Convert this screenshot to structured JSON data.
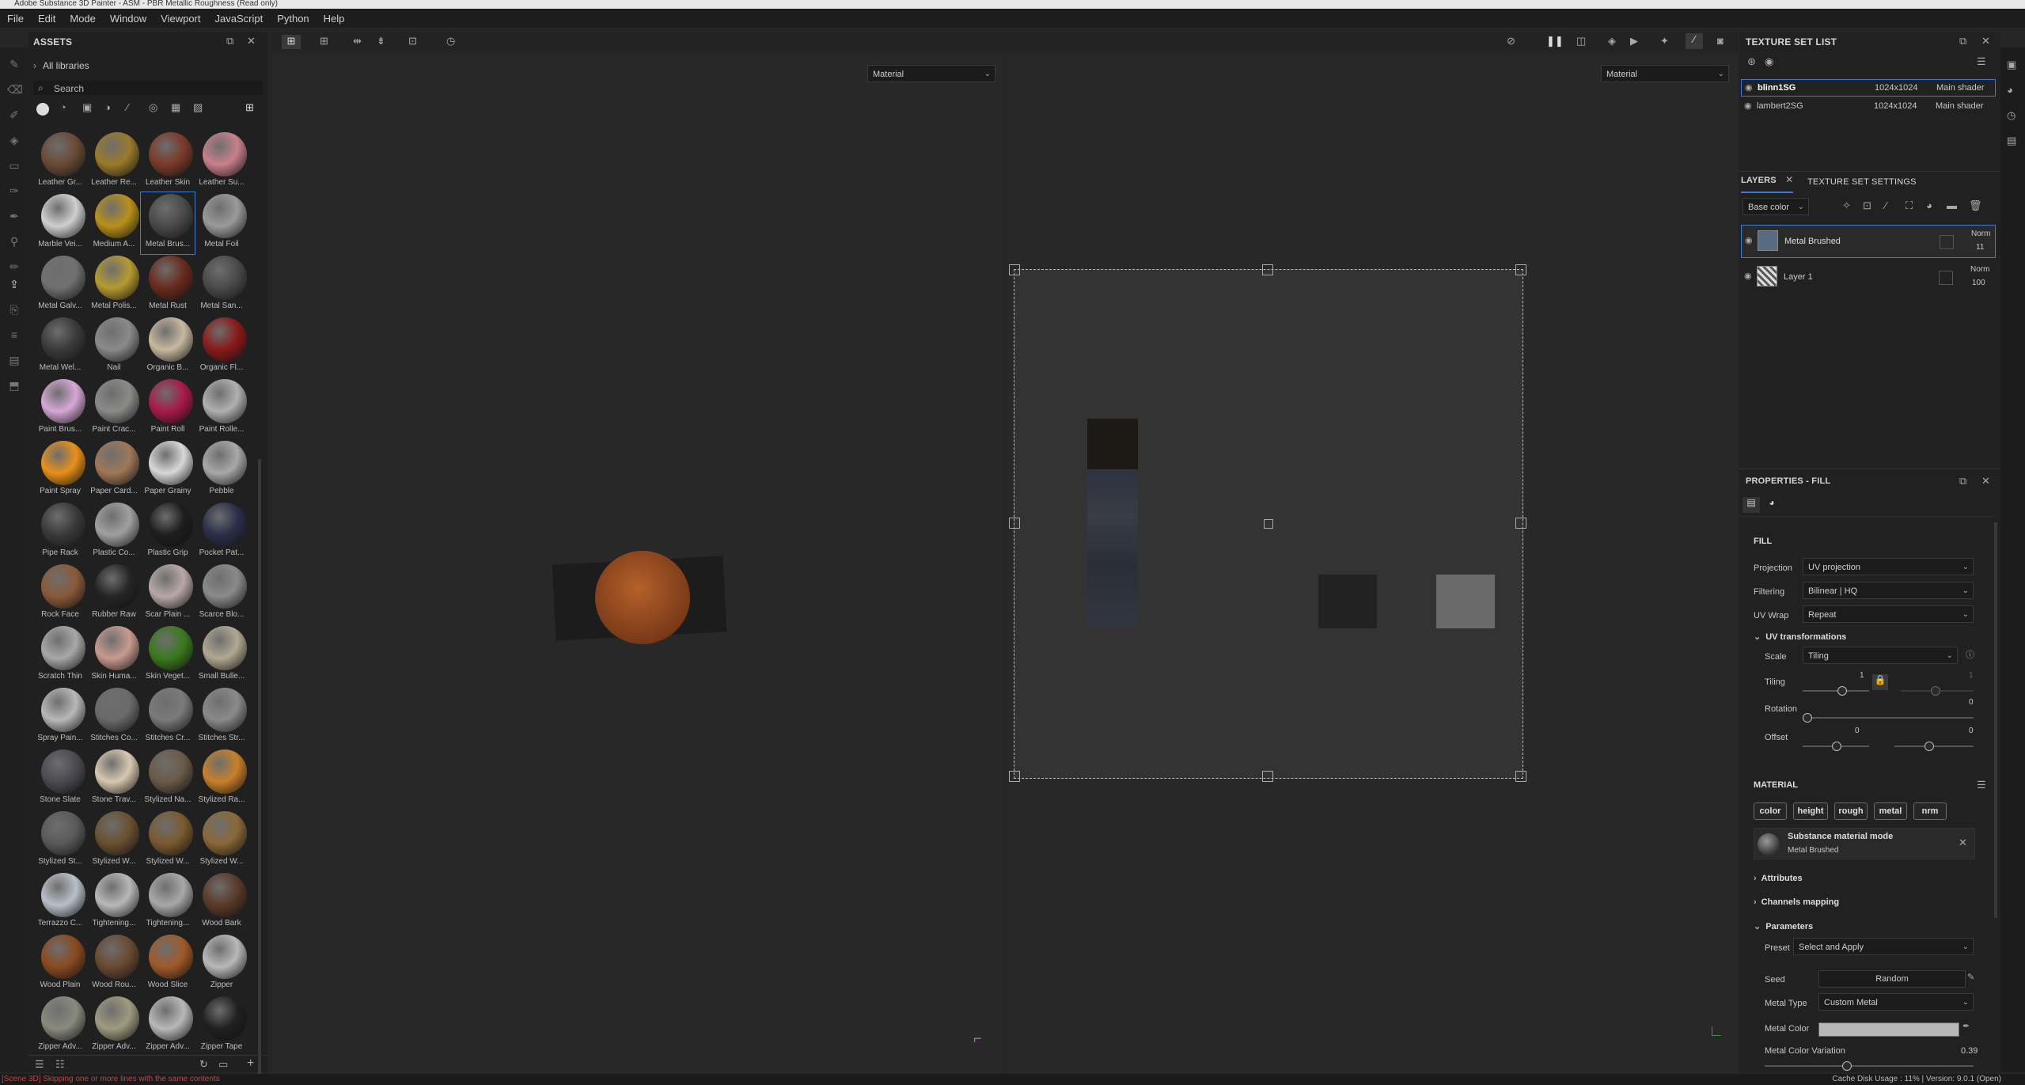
{
  "window_title": "Adobe Substance 3D Painter - ASM - PBR Metallic Roughness (Read only)",
  "menu": [
    "File",
    "Edit",
    "Mode",
    "Window",
    "Viewport",
    "JavaScript",
    "Python",
    "Help"
  ],
  "assets": {
    "title": "ASSETS",
    "library": "All libraries",
    "search_placeholder": "Search",
    "items": [
      {
        "label": "Leather Gr...",
        "color": "#6a4a35"
      },
      {
        "label": "Leather Re...",
        "color": "#9a7a2a"
      },
      {
        "label": "Leather Skin",
        "color": "#7a3a28"
      },
      {
        "label": "Leather Su...",
        "color": "#c9808a"
      },
      {
        "label": "Marble Vei...",
        "color": "#cfcfcf"
      },
      {
        "label": "Medium A...",
        "color": "#b8901a"
      },
      {
        "label": "Metal Brus...",
        "color": "#4a4a4a"
      },
      {
        "label": "Metal Foil",
        "color": "#9a9a9a"
      },
      {
        "label": "Metal Galv...",
        "color": "#707070"
      },
      {
        "label": "Metal Polis...",
        "color": "#b59a30"
      },
      {
        "label": "Metal Rust",
        "color": "#6a2a1e"
      },
      {
        "label": "Metal San...",
        "color": "#4a4a4a"
      },
      {
        "label": "Metal Wel...",
        "color": "#3a3a3a"
      },
      {
        "label": "Nail",
        "color": "#8a8a8a"
      },
      {
        "label": "Organic B...",
        "color": "#c8b8a0"
      },
      {
        "label": "Organic Fl...",
        "color": "#8a1a1a"
      },
      {
        "label": "Paint Brus...",
        "color": "#d6a8d8"
      },
      {
        "label": "Paint Crac...",
        "color": "#8a8a88"
      },
      {
        "label": "Paint Roll",
        "color": "#a81a4a"
      },
      {
        "label": "Paint Rolle...",
        "color": "#b0b0b0"
      },
      {
        "label": "Paint Spray",
        "color": "#e8901a"
      },
      {
        "label": "Paper Card...",
        "color": "#a07858"
      },
      {
        "label": "Paper Grainy",
        "color": "#d8d8d8"
      },
      {
        "label": "Pebble",
        "color": "#a8a8a8"
      },
      {
        "label": "Pipe Rack",
        "color": "#3a3a3a"
      },
      {
        "label": "Plastic Co...",
        "color": "#a0a0a0"
      },
      {
        "label": "Plastic Grip",
        "color": "#1e1e1e"
      },
      {
        "label": "Pocket Pat...",
        "color": "#2a2f4a"
      },
      {
        "label": "Rock Face",
        "color": "#8a5a38"
      },
      {
        "label": "Rubber Raw",
        "color": "#252525"
      },
      {
        "label": "Scar Plain ...",
        "color": "#b8a8a8"
      },
      {
        "label": "Scarce Blo...",
        "color": "#8a8a8a"
      },
      {
        "label": "Scratch Thin",
        "color": "#a8a8a8"
      },
      {
        "label": "Skin Huma...",
        "color": "#c89a90"
      },
      {
        "label": "Skin Veget...",
        "color": "#3a7a1e"
      },
      {
        "label": "Small Bulle...",
        "color": "#b0a890"
      },
      {
        "label": "Spray Pain...",
        "color": "#b8b8b8"
      },
      {
        "label": "Stitches Co...",
        "color": "#6a6a6a"
      },
      {
        "label": "Stitches Cr...",
        "color": "#7a7a7a"
      },
      {
        "label": "Stitches Str...",
        "color": "#8a8a8a"
      },
      {
        "label": "Stone Slate",
        "color": "#4a4a52"
      },
      {
        "label": "Stone Trav...",
        "color": "#d8c8b0"
      },
      {
        "label": "Stylized Na...",
        "color": "#6a5a48"
      },
      {
        "label": "Stylized Ra...",
        "color": "#c8802a"
      },
      {
        "label": "Stylized St...",
        "color": "#5a5a5a"
      },
      {
        "label": "Stylized W...",
        "color": "#6a5030"
      },
      {
        "label": "Stylized W...",
        "color": "#7a5a30"
      },
      {
        "label": "Stylized W...",
        "color": "#8a6838"
      },
      {
        "label": "Terrazzo C...",
        "color": "#b8c0c8"
      },
      {
        "label": "Tightening...",
        "color": "#b8b8b8"
      },
      {
        "label": "Tightening...",
        "color": "#a8a8a8"
      },
      {
        "label": "Wood Bark",
        "color": "#5a3a28"
      },
      {
        "label": "Wood Plain",
        "color": "#8a4a20"
      },
      {
        "label": "Wood Rou...",
        "color": "#6a4a30"
      },
      {
        "label": "Wood Slice",
        "color": "#a05a28"
      },
      {
        "label": "Zipper",
        "color": "#b8b8b8"
      },
      {
        "label": "Zipper Adv...",
        "color": "#8a8a80"
      },
      {
        "label": "Zipper Adv...",
        "color": "#a09a80"
      },
      {
        "label": "Zipper Adv...",
        "color": "#b8b8b8"
      },
      {
        "label": "Zipper Tape",
        "color": "#202020"
      }
    ]
  },
  "viewport": {
    "left_mode": "Material",
    "right_mode": "Material"
  },
  "texture_set_list": {
    "title": "TEXTURE SET LIST",
    "sets": [
      {
        "name": "blinn1SG",
        "res": "1024x1024",
        "shader": "Main shader"
      },
      {
        "name": "lambert2SG",
        "res": "1024x1024",
        "shader": "Main shader"
      }
    ]
  },
  "layers": {
    "tab_layers": "LAYERS",
    "tab_tss": "TEXTURE SET SETTINGS",
    "channel": "Base color",
    "items": [
      {
        "name": "Metal Brushed",
        "blend": "Norm",
        "opacity": "11"
      },
      {
        "name": "Layer 1",
        "blend": "Norm",
        "opacity": "100"
      }
    ]
  },
  "properties": {
    "title": "PROPERTIES - FILL",
    "fill_label": "FILL",
    "projection_label": "Projection",
    "projection": "UV projection",
    "filtering_label": "Filtering",
    "filtering": "Bilinear | HQ",
    "uvwrap_label": "UV Wrap",
    "uvwrap": "Repeat",
    "uvt_label": "UV transformations",
    "scale_label": "Scale",
    "scale": "Tiling",
    "tiling_label": "Tiling",
    "tiling_a": "1",
    "tiling_b": "1",
    "rotation_label": "Rotation",
    "rotation": "0",
    "offset_label": "Offset",
    "offset_a": "0",
    "offset_b": "0",
    "material_label": "MATERIAL",
    "chips": [
      "color",
      "height",
      "rough",
      "metal",
      "nrm"
    ],
    "mat_mode_title": "Substance material mode",
    "mat_mode_sub": "Metal Brushed",
    "attributes": "Attributes",
    "channels_mapping": "Channels mapping",
    "parameters": "Parameters",
    "preset_label": "Preset",
    "preset": "Select and Apply",
    "seed_label": "Seed",
    "seed": "Random",
    "metal_type_label": "Metal Type",
    "metal_type": "Custom Metal",
    "metal_color_label": "Metal Color",
    "metal_color": "#b8b8b8",
    "mcv_label": "Metal Color Variation",
    "mcv": "0.39"
  },
  "status": {
    "left": "[Scene 3D] Skipping one or more lines with the same contents",
    "right": "Cache Disk Usage : 11% | Version: 9.0.1 (Open)"
  }
}
